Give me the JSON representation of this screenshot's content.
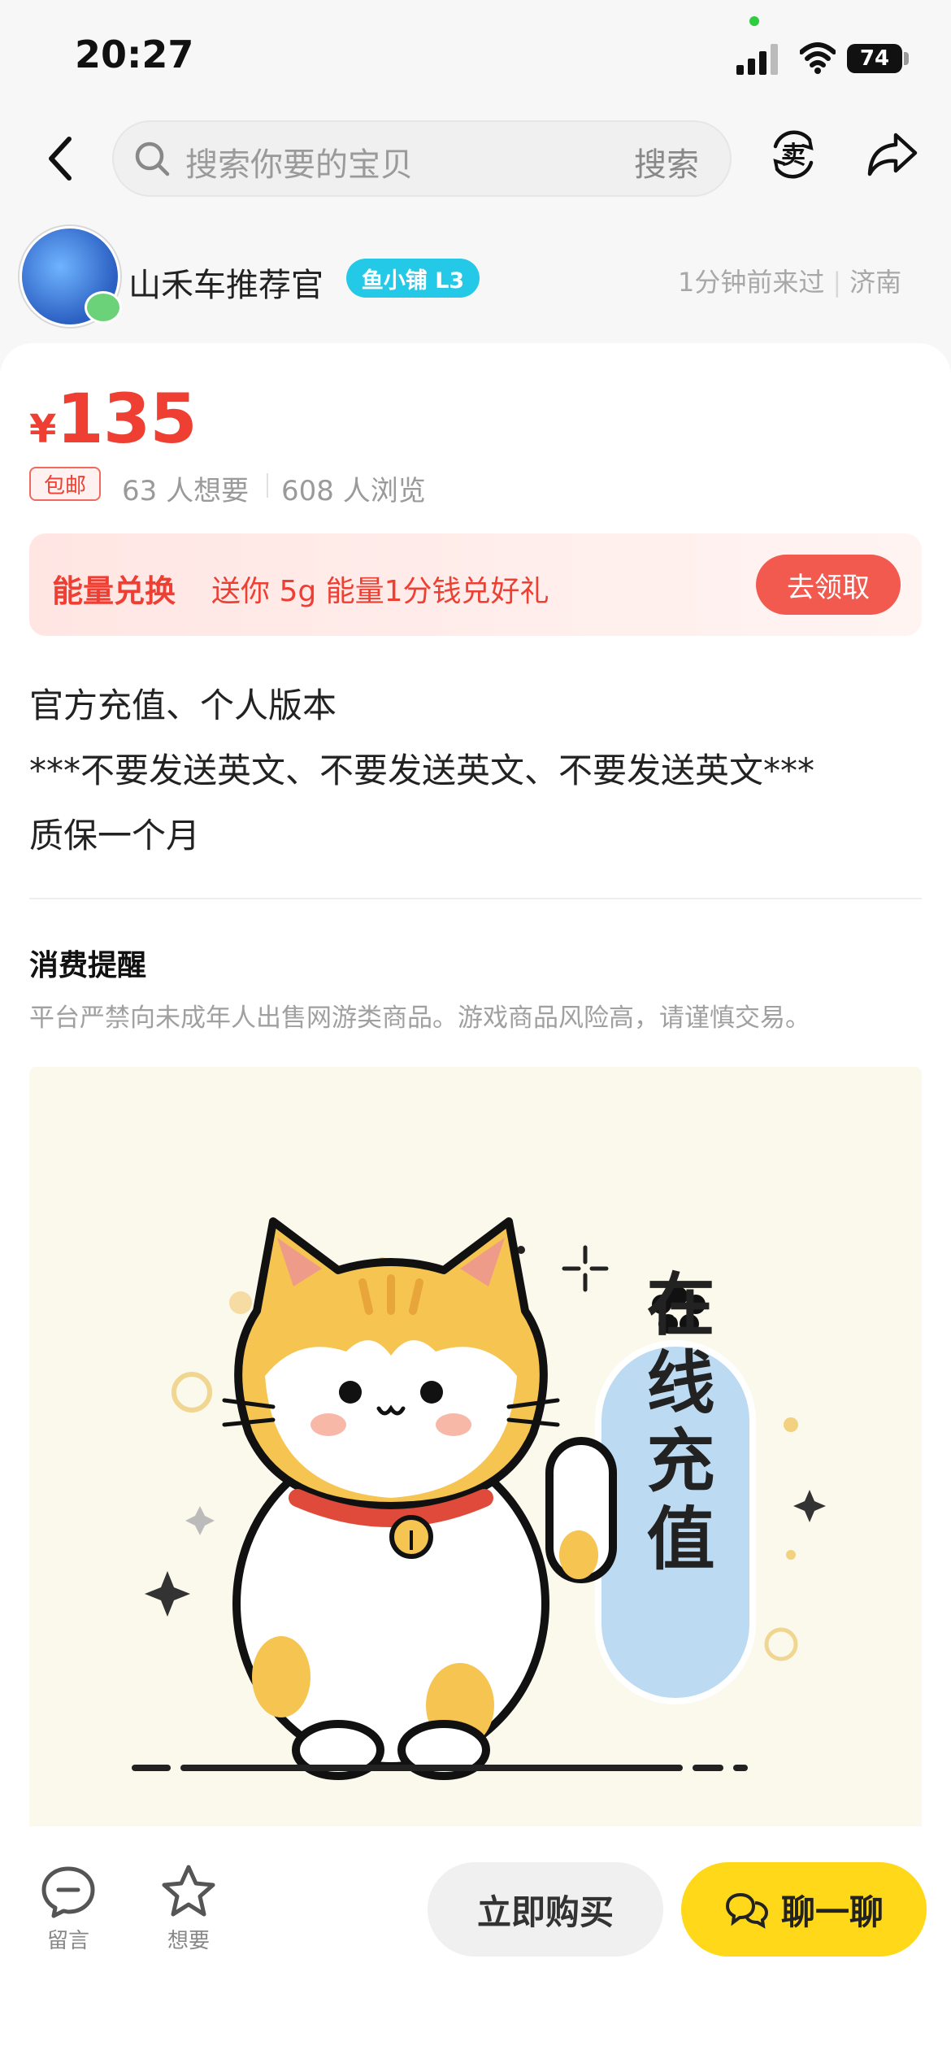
{
  "status_bar": {
    "time": "20:27",
    "battery": "74"
  },
  "nav": {
    "search_placeholder": "搜索你要的宝贝",
    "search_button": "搜索"
  },
  "seller": {
    "name": "山禾车推荐官",
    "badge": "鱼小铺 L3",
    "last_seen": "1分钟前来过",
    "location": "济南"
  },
  "product": {
    "currency": "¥",
    "price": "135",
    "free_shipping": "包邮",
    "wants": "63 人想要",
    "views": "608 人浏览",
    "promo": {
      "title": "能量兑换",
      "text": "送你 5g 能量1分钱兑好礼",
      "button": "去领取"
    },
    "description_lines": [
      "官方充值、个人版本",
      "***不要发送英文、不要发送英文、不要发送英文***",
      "质保一个月"
    ],
    "notice": {
      "title": "消费提醒",
      "text": "平台严禁向未成年人出售网游类商品。游戏商品风险高，请谨慎交易。"
    },
    "image_caption": "在线充值"
  },
  "bottom_bar": {
    "comment_label": "留言",
    "fav_label": "想要",
    "buy_button": "立即购买",
    "chat_button": "聊一聊"
  },
  "icons": [
    "back-icon",
    "search-icon",
    "sell-icon",
    "share-icon",
    "comment-icon",
    "star-icon",
    "chat-icon",
    "signal-icon",
    "wifi-icon"
  ],
  "colors": {
    "price_red": "#ef3f33",
    "chat_yellow": "#ffd81a",
    "badge_cyan": "#23c9e6"
  }
}
